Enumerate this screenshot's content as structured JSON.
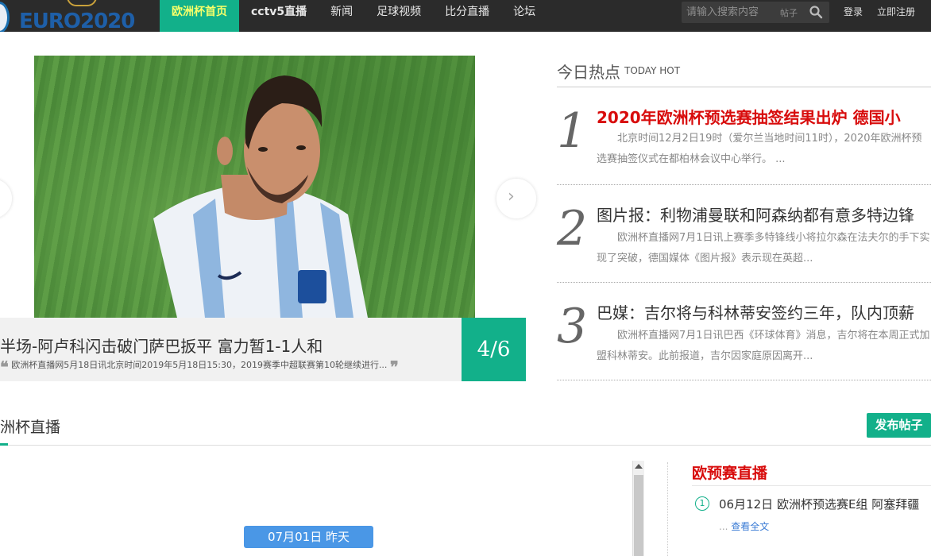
{
  "header": {
    "logo_text": "EURO2020",
    "nav": [
      {
        "label": "欧洲杯首页"
      },
      {
        "label": "cctv5直播"
      },
      {
        "label": "新闻"
      },
      {
        "label": "足球视频"
      },
      {
        "label": "比分直播"
      },
      {
        "label": "论坛"
      }
    ],
    "search": {
      "placeholder": "请输入搜索内容",
      "scope": "帖子",
      "icon": "search-icon"
    },
    "login": "登录",
    "register": "立即注册"
  },
  "slider": {
    "caption_title": "半场-阿卢科闪击破门萨巴扳平 富力暂1-1人和",
    "caption_desc": "欧洲杯直播网5月18日讯北京时间2019年5月18日15:30，2019赛季中超联赛第10轮继续进行...",
    "open_quote": "❝",
    "close_quote": "❞",
    "counter": "4/6",
    "next_arrow": "›"
  },
  "today_hot": {
    "title": "今日热点",
    "title_en": "TODAY HOT",
    "items": [
      {
        "num": "1",
        "title": "2020年欧洲杯预选赛抽签结果出炉 德国小",
        "desc": "北京时间12月2日19时（爱尔兰当地时间11时），2020年欧洲杯预选赛抽签仪式在都柏林会议中心举行。 ..."
      },
      {
        "num": "2",
        "title": "图片报：利物浦曼联和阿森纳都有意多特边锋",
        "desc": "欧洲杯直播网7月1日讯上赛季多特锋线小将拉尔森在法夫尔的手下实现了突破，德国媒体《图片报》表示现在英超..."
      },
      {
        "num": "3",
        "title": "巴媒：吉尔将与科林蒂安签约三年，队内顶薪",
        "desc": "欧洲杯直播网7月1日讯巴西《环球体育》消息，吉尔将在本周正式加盟科林蒂安。此前报道，吉尔因家庭原因离开..."
      }
    ]
  },
  "live": {
    "title": "洲杯直播",
    "publish_button": "发布帖子",
    "date_pill": "07月01日 昨天",
    "euro_title": "欧预赛直播",
    "euro_items": [
      {
        "num": "1",
        "text": "06月12日 欧洲杯预选赛E组 阿塞拜疆"
      }
    ],
    "more_dots": "...",
    "more_label": "查看全文"
  },
  "colors": {
    "accent": "#12b08a",
    "hot_red": "#d80c0c",
    "nav_bg": "#2b2b2b",
    "link_blue": "#3a7bd5",
    "pill_blue": "#4a97e6"
  }
}
